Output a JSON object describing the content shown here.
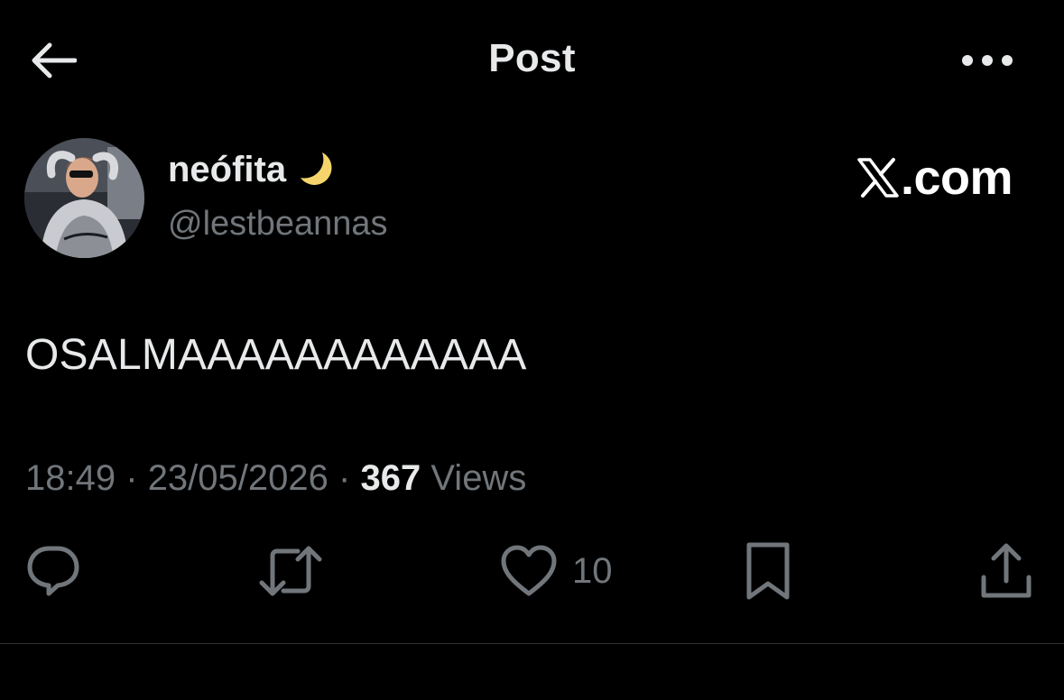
{
  "header": {
    "title": "Post",
    "back_icon": "arrow-left-icon",
    "more_icon": "more-horizontal-icon"
  },
  "author": {
    "display_name": "neófita",
    "name_emoji": "crescent-moon-icon",
    "handle": "@lestbeannas"
  },
  "brand": {
    "text": ".com",
    "logo_icon": "x-logo-icon"
  },
  "post": {
    "text": "OSALMAAAAAAAAAAAA"
  },
  "meta": {
    "time": "18:49",
    "date": "23/05/2026",
    "separator": "·",
    "views_count": "367",
    "views_label": "Views"
  },
  "actions": {
    "reply_icon": "reply-icon",
    "repost_icon": "repost-icon",
    "like_icon": "heart-icon",
    "like_count": "10",
    "bookmark_icon": "bookmark-icon",
    "share_icon": "share-icon"
  },
  "colors": {
    "background": "#000000",
    "text_primary": "#e7e9ea",
    "text_secondary": "#71767b",
    "divider": "#2f3336",
    "moon": "#f5d56b"
  }
}
